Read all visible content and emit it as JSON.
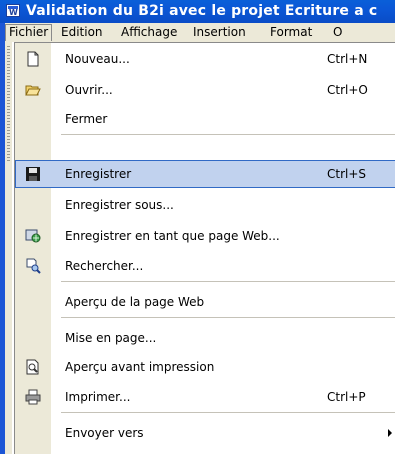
{
  "window": {
    "title": "Validation du B2i avec le projet Ecriture a c"
  },
  "menubar": {
    "items": [
      {
        "label": "Fichier",
        "key": "F"
      },
      {
        "label": "Edition",
        "key": "E"
      },
      {
        "label": "Affichage",
        "key": "A"
      },
      {
        "label": "Insertion",
        "key": "I"
      },
      {
        "label": "Format",
        "key": "t"
      },
      {
        "label": "O",
        "key": "O"
      }
    ]
  },
  "file_menu": {
    "items": [
      {
        "label": "Nouveau...",
        "shortcut": "Ctrl+N",
        "icon": "new-document-icon"
      },
      {
        "label": "Ouvrir...",
        "shortcut": "Ctrl+O",
        "icon": "open-folder-icon"
      },
      {
        "label": "Fermer",
        "shortcut": "",
        "icon": ""
      },
      {
        "label": "Enregistrer",
        "shortcut": "Ctrl+S",
        "icon": "save-disk-icon",
        "highlighted": true
      },
      {
        "label": "Enregistrer sous...",
        "shortcut": "",
        "icon": ""
      },
      {
        "label": "Enregistrer en tant que page Web...",
        "shortcut": "",
        "icon": "save-as-web-icon"
      },
      {
        "label": "Rechercher...",
        "shortcut": "",
        "icon": "search-file-icon"
      },
      {
        "label": "Aperçu de la page Web",
        "shortcut": "",
        "icon": ""
      },
      {
        "label": "Mise en page...",
        "shortcut": "",
        "icon": ""
      },
      {
        "label": "Aperçu avant impression",
        "shortcut": "",
        "icon": "print-preview-icon"
      },
      {
        "label": "Imprimer...",
        "shortcut": "Ctrl+P",
        "icon": "printer-icon"
      },
      {
        "label": "Envoyer vers",
        "shortcut": "",
        "icon": "",
        "submenu": true
      }
    ]
  },
  "colors": {
    "title_bar": "#0a5fd8",
    "menu_bar": "#ece9d8",
    "highlight": "#c1d2ee",
    "highlight_border": "#316ac5"
  }
}
